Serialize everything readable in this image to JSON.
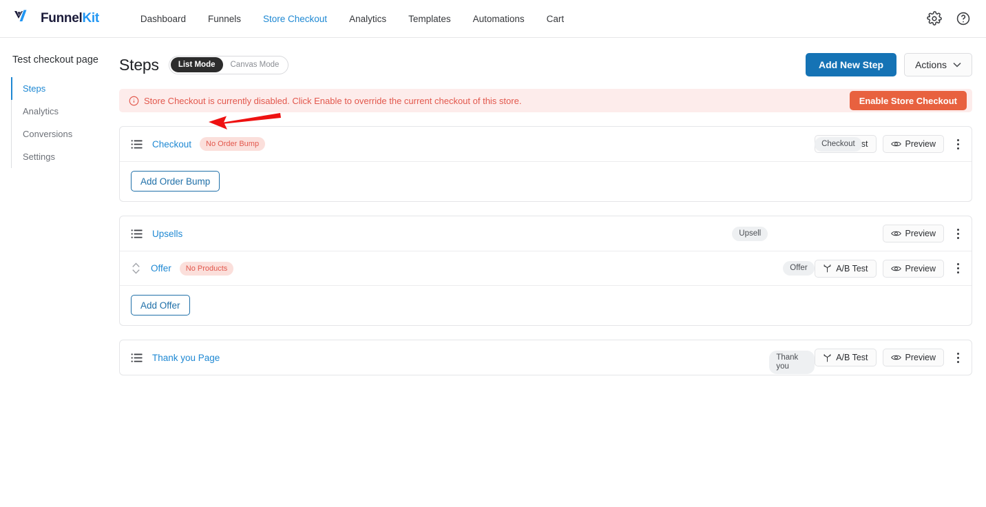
{
  "brand": {
    "name_part1": "Funnel",
    "name_part2": "Kit",
    "logo_icon": "funnelkit-logo-icon",
    "accent_blue": "#2196f3",
    "dark_navy": "#1b1b3a"
  },
  "topnav": {
    "items": [
      {
        "label": "Dashboard",
        "active": false
      },
      {
        "label": "Funnels",
        "active": false
      },
      {
        "label": "Store Checkout",
        "active": true
      },
      {
        "label": "Analytics",
        "active": false
      },
      {
        "label": "Templates",
        "active": false
      },
      {
        "label": "Automations",
        "active": false
      },
      {
        "label": "Cart",
        "active": false
      }
    ],
    "right_icons": [
      {
        "name": "gear-icon"
      },
      {
        "name": "help-circle-icon"
      }
    ]
  },
  "sidebar": {
    "title": "Test checkout page",
    "items": [
      {
        "label": "Steps",
        "active": true
      },
      {
        "label": "Analytics",
        "active": false
      },
      {
        "label": "Conversions",
        "active": false
      },
      {
        "label": "Settings",
        "active": false
      }
    ]
  },
  "header": {
    "title": "Steps",
    "mode_toggle": {
      "list_mode": "List Mode",
      "canvas_mode": "Canvas Mode",
      "selected": "List Mode"
    },
    "add_new_step": "Add New Step",
    "actions": "Actions"
  },
  "notice": {
    "icon": "info-circle-icon",
    "text": "Store Checkout is currently disabled. Click Enable to override the current checkout of this store.",
    "button": "Enable Store Checkout",
    "bg_color": "#fdeceb",
    "text_color": "#e2574c",
    "button_color": "#e8613f"
  },
  "steps": [
    {
      "name": "Checkout",
      "badge": "No Order Bump",
      "type": "Checkout",
      "ab_test": "A/B Test",
      "preview": "Preview",
      "footer_button": "Add Order Bump"
    },
    {
      "name": "Upsells",
      "type": "Upsell",
      "preview": "Preview",
      "child": {
        "name": "Offer",
        "badge": "No Products",
        "type": "Offer",
        "ab_test": "A/B Test",
        "preview": "Preview"
      },
      "footer_button": "Add Offer"
    },
    {
      "name": "Thank you Page",
      "type": "Thank you",
      "ab_test": "A/B Test",
      "preview": "Preview"
    }
  ],
  "annotation": {
    "type": "red-arrow",
    "direction": "left",
    "color": "#ee1111"
  }
}
